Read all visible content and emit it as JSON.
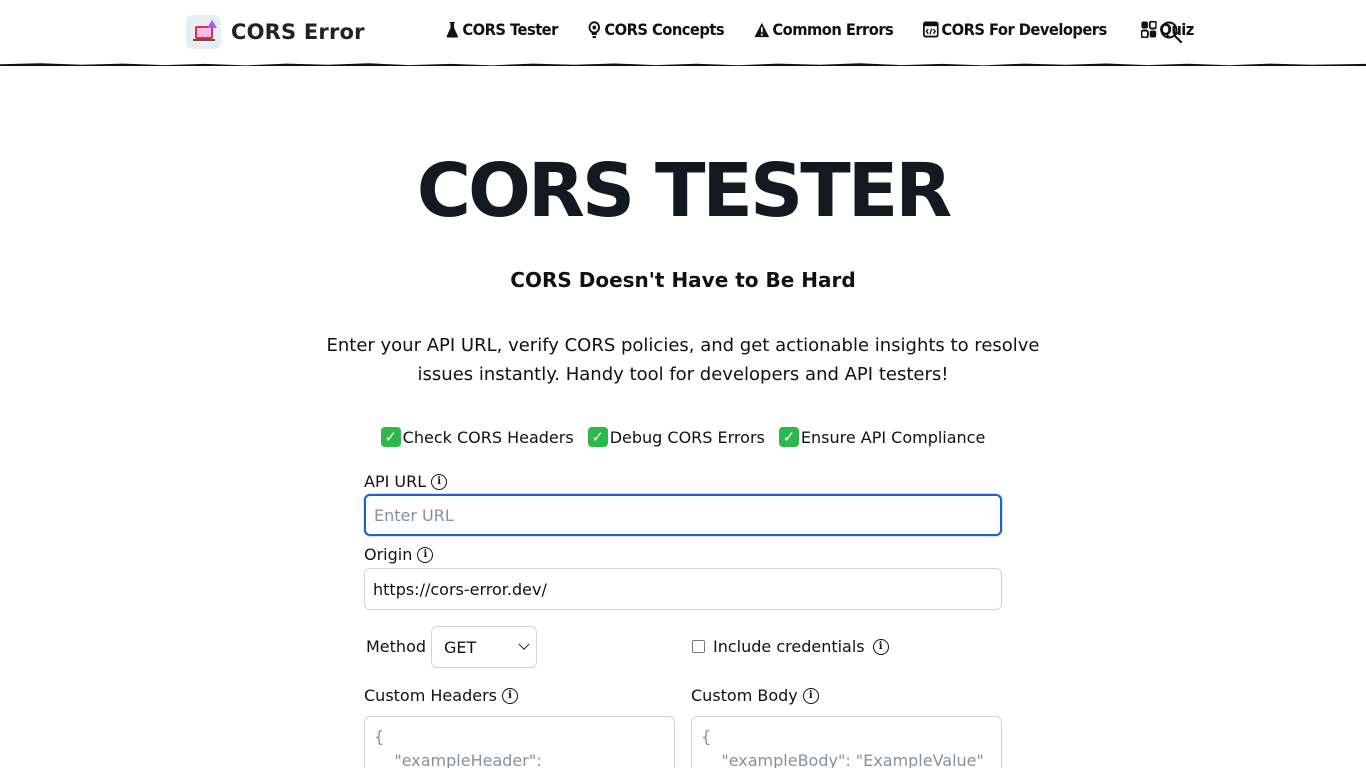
{
  "header": {
    "logo_text": "CORS Error",
    "nav": [
      {
        "label": "CORS Tester",
        "icon": "flask-icon"
      },
      {
        "label": "CORS Concepts",
        "icon": "lightbulb-icon"
      },
      {
        "label": "Common Errors",
        "icon": "warning-icon"
      },
      {
        "label": "CORS For Developers",
        "icon": "code-window-icon"
      },
      {
        "label": "Quiz",
        "icon": "grid-apps-icon"
      }
    ],
    "search_icon": "search-icon"
  },
  "hero": {
    "title": "CORS TESTER",
    "subtitle": "CORS Doesn't Have to Be Hard",
    "description": "Enter your API URL, verify CORS policies, and get actionable insights to resolve issues instantly. Handy tool for developers and API testers!"
  },
  "features": [
    {
      "label": "Check CORS Headers"
    },
    {
      "label": "Debug CORS Errors"
    },
    {
      "label": "Ensure API Compliance"
    }
  ],
  "form": {
    "api_url_label": "API URL",
    "api_url_placeholder": "Enter URL",
    "api_url_value": "",
    "origin_label": "Origin",
    "origin_value": "https://cors-error.dev/",
    "method_label": "Method",
    "method_value": "GET",
    "credentials_label": "Include credentials",
    "credentials_checked": false,
    "custom_headers_label": "Custom Headers",
    "custom_headers_placeholder": "{\n    \"exampleHeader\":",
    "custom_body_label": "Custom Body",
    "custom_body_placeholder": "{\n    \"exampleBody\": \"ExampleValue\""
  },
  "colors": {
    "focus_border": "#1d63c9",
    "check_green": "#2db84b",
    "title_text": "#141821"
  }
}
